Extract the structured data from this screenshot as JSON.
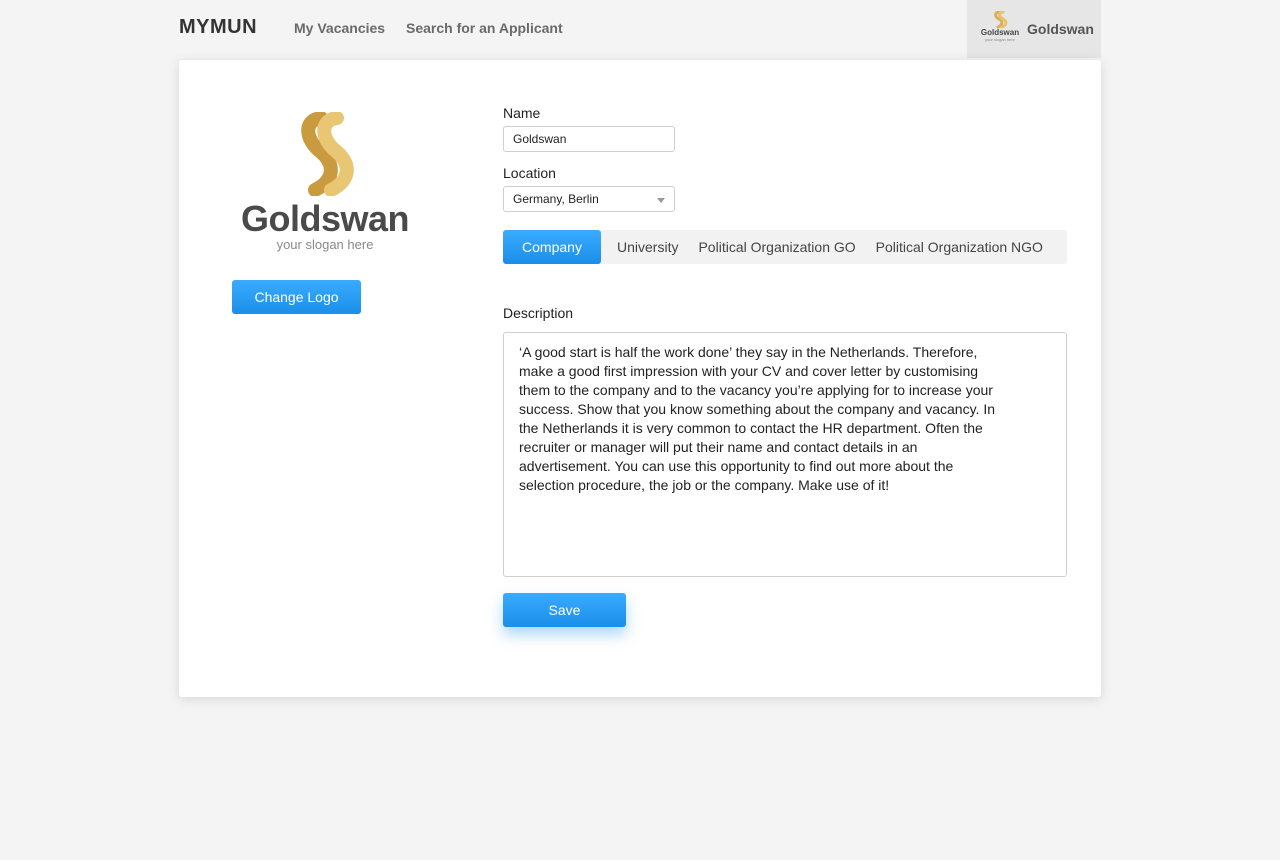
{
  "header": {
    "brand": "MYMUN",
    "nav": {
      "vacancies": "My Vacancies",
      "search": "Search for an Applicant"
    },
    "account": {
      "logo_word": "Goldswan",
      "logo_slogan": "your slogan here",
      "name": "Goldswan"
    }
  },
  "profile": {
    "logo": {
      "word": "Goldswan",
      "slogan": "your slogan here",
      "colors": {
        "gold": "#d8b05a",
        "text": "#4a4a4a"
      }
    },
    "change_logo_label": "Change Logo",
    "name": {
      "label": "Name",
      "value": "Goldswan"
    },
    "location": {
      "label": "Location",
      "value": "Germany, Berlin"
    },
    "tabs": [
      {
        "label": "Company",
        "active": true
      },
      {
        "label": "University",
        "active": false
      },
      {
        "label": "Political Organization GO",
        "active": false
      },
      {
        "label": "Political Organization NGO",
        "active": false
      }
    ],
    "description": {
      "label": "Description",
      "value": "‘A good start is half the work done’ they say in the Netherlands. Therefore, make a good first impression with your CV and cover letter by customising them to the company and to the vacancy you’re applying for to increase your success. Show that you know something about the company and vacancy. In the Netherlands it is very common to contact the HR department. Often the recruiter or manager will put their name and contact details in an advertisement. You can use this opportunity to find out more about the selection procedure, the job or the company. Make use of it!"
    },
    "save_label": "Save"
  },
  "colors": {
    "accent": "#1a8ee8",
    "background": "#f4f4f4"
  }
}
